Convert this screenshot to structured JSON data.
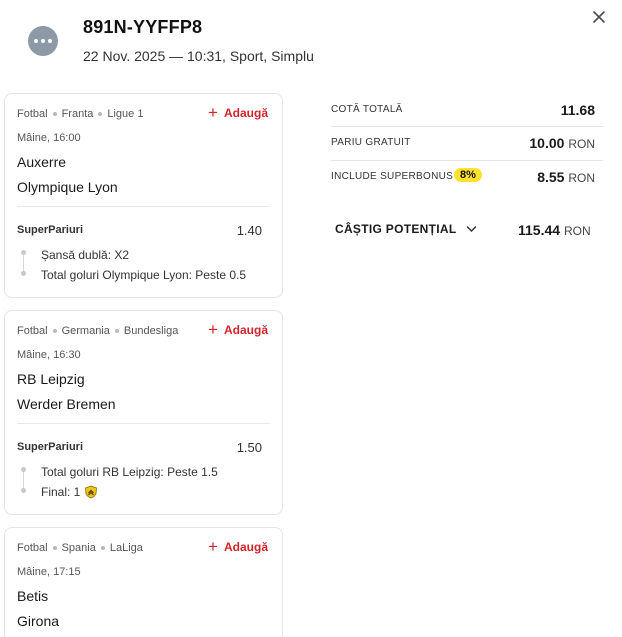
{
  "header": {
    "ticket_id": "891N-YYFFP8",
    "subtitle": "22 Nov. 2025 — 10:31, Sport, Simplu",
    "menu_icon": "more-horizontal-icon",
    "close_icon": "close-icon"
  },
  "add_label": "Adaugă",
  "events": [
    {
      "sport": "Fotbal",
      "country": "Franta",
      "league": "Ligue 1",
      "time": "Mâine, 16:00",
      "home": "Auxerre",
      "away": "Olympique Lyon",
      "market": "SuperPariuri",
      "odds": "1.40",
      "selections": [
        "Șansă dublă: X2",
        "Total goluri Olympique Lyon: Peste 0.5"
      ]
    },
    {
      "sport": "Fotbal",
      "country": "Germania",
      "league": "Bundesliga",
      "time": "Mâine, 16:30",
      "home": "RB Leipzig",
      "away": "Werder Bremen",
      "market": "SuperPariuri",
      "odds": "1.50",
      "selections": [
        "Total goluri RB Leipzig: Peste 1.5",
        "Final: 1"
      ]
    },
    {
      "sport": "Fotbal",
      "country": "Spania",
      "league": "LaLiga",
      "time": "Mâine, 17:15",
      "home": "Betis",
      "away": "Girona"
    }
  ],
  "summary": {
    "total_odds_label": "COTĂ TOTALĂ",
    "total_odds": "11.68",
    "free_bet_label": "PARIU GRATUIT",
    "free_bet": "10.00",
    "superbonus_label": "INCLUDE SUPERBONUS",
    "superbonus_pct": "8%",
    "superbonus_value": "8.55",
    "currency": "RON",
    "potential_win_label": "CÂȘTIG POTENȚIAL",
    "potential_win": "115.44"
  },
  "colors": {
    "accent_red": "#d4232b",
    "badge_yellow": "#ffe12e",
    "avatar_gray": "#8e99a6"
  }
}
